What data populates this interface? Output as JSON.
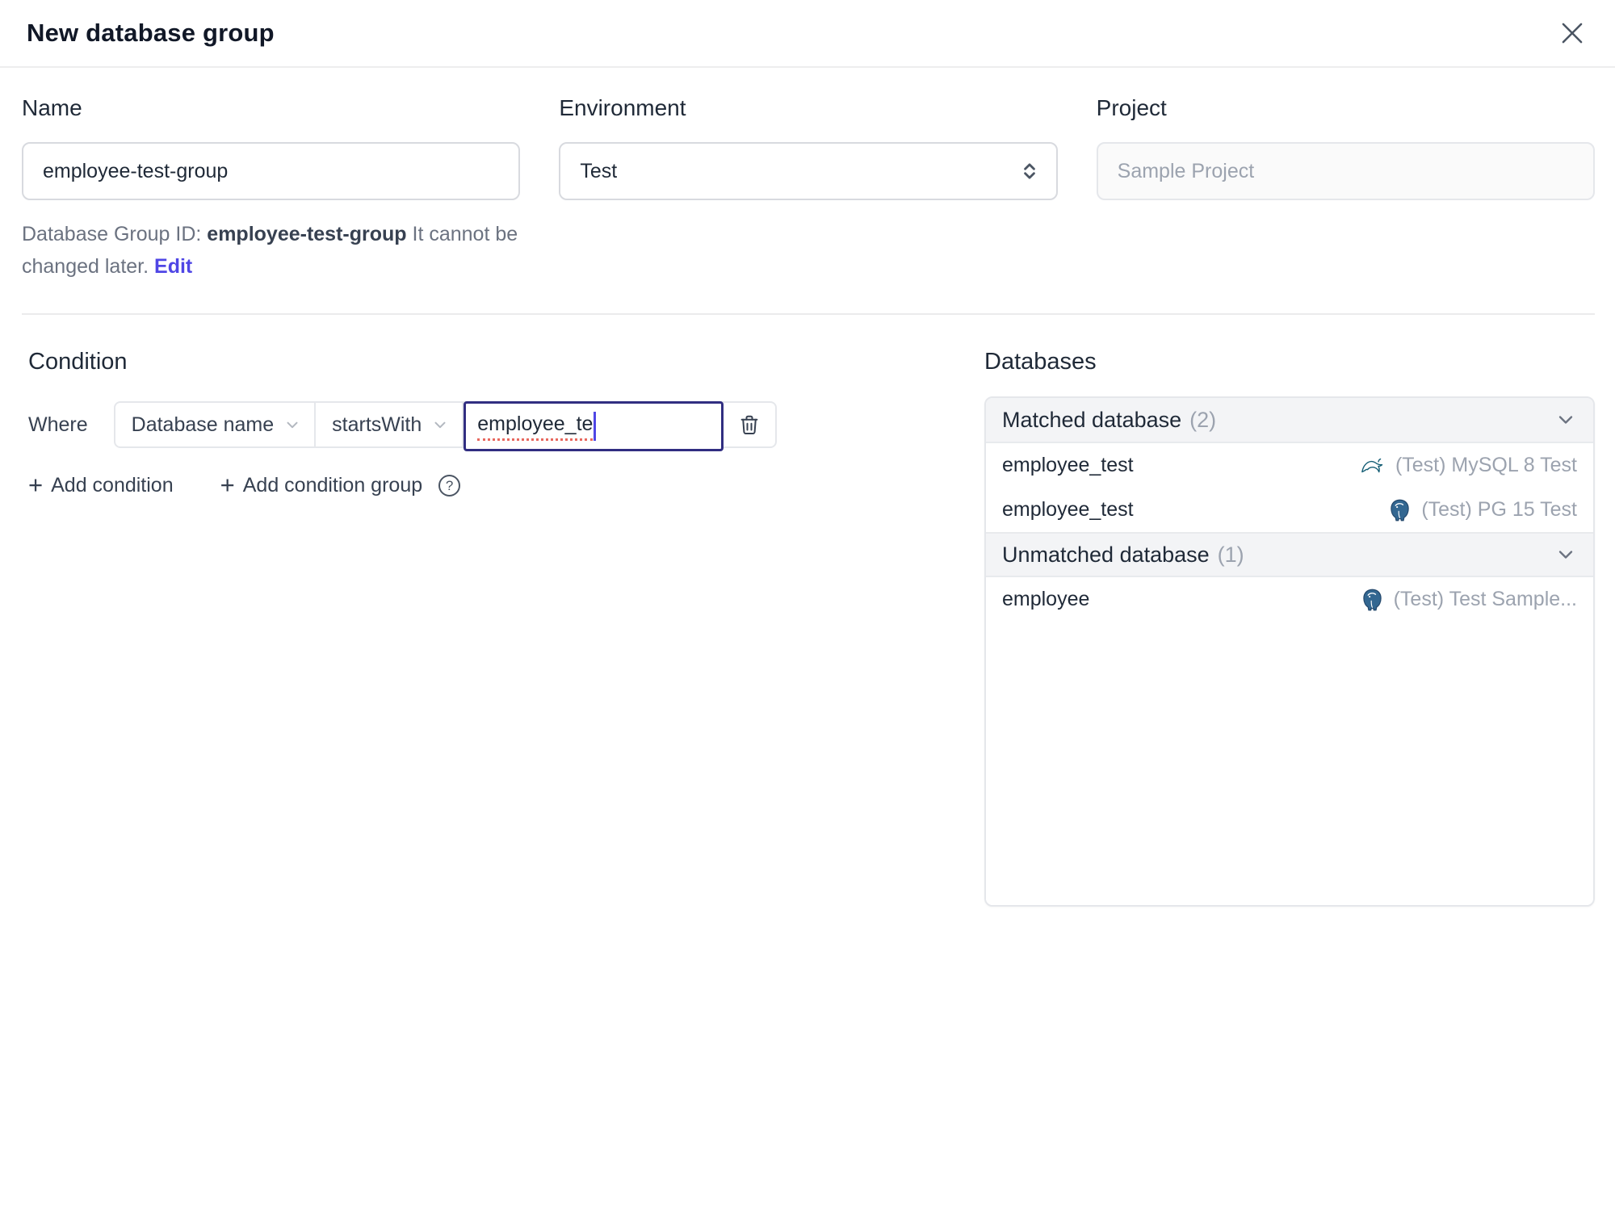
{
  "header": {
    "title": "New database group"
  },
  "form": {
    "name": {
      "label": "Name",
      "value": "employee-test-group"
    },
    "environment": {
      "label": "Environment",
      "value": "Test"
    },
    "project": {
      "label": "Project",
      "value": "Sample Project"
    },
    "id_helper": {
      "prefix": "Database Group ID: ",
      "id": "employee-test-group",
      "suffix": " It cannot be changed later. ",
      "edit_label": "Edit"
    }
  },
  "condition": {
    "title": "Condition",
    "where_label": "Where",
    "field_selected": "Database name",
    "operator_selected": "startsWith",
    "value": "employee_te",
    "add_condition_label": "Add condition",
    "add_condition_group_label": "Add condition group",
    "help_glyph": "?"
  },
  "databases": {
    "title": "Databases",
    "sections": [
      {
        "label": "Matched database",
        "count": "(2)",
        "rows": [
          {
            "name": "employee_test",
            "engine": "mysql",
            "instance": "(Test) MySQL 8 Test"
          },
          {
            "name": "employee_test",
            "engine": "postgresql",
            "instance": "(Test) PG 15 Test"
          }
        ]
      },
      {
        "label": "Unmatched database",
        "count": "(1)",
        "rows": [
          {
            "name": "employee",
            "engine": "postgresql",
            "instance": "(Test) Test Sample..."
          }
        ]
      }
    ]
  },
  "icons": {
    "close": "x-cross",
    "environment_select": "up-down-chevrons",
    "dropdown": "chevron-down",
    "delete_condition": "trash-can",
    "help": "question-circle",
    "section_collapse": "chevron-down",
    "mysql": "dolphin-logo",
    "postgresql": "elephant-logo"
  },
  "colors": {
    "focus_border": "#312e81",
    "link": "#4f46e5",
    "spellcheck_underline": "#e8685f",
    "section_header_bg": "#f3f4f6",
    "border": "#e5e7eb",
    "muted_text": "#9ca3af",
    "mysql_teal": "#155e75",
    "postgres_blue": "#336791"
  }
}
